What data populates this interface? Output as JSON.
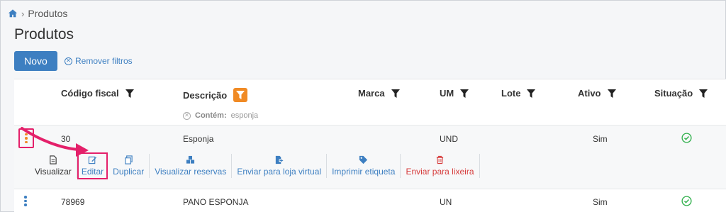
{
  "breadcrumb": {
    "home_icon": "home-icon",
    "current": "Produtos"
  },
  "page": {
    "title": "Produtos"
  },
  "toolbar": {
    "new_label": "Novo",
    "remove_filters_label": "Remover filtros"
  },
  "table": {
    "columns": [
      {
        "key": "codigo_fiscal",
        "label": "Código fiscal"
      },
      {
        "key": "descricao",
        "label": "Descrição",
        "filter_active": true
      },
      {
        "key": "marca",
        "label": "Marca"
      },
      {
        "key": "um",
        "label": "UM"
      },
      {
        "key": "lote",
        "label": "Lote"
      },
      {
        "key": "ativo",
        "label": "Ativo"
      },
      {
        "key": "situacao",
        "label": "Situação"
      }
    ],
    "active_filter": {
      "label": "Contém:",
      "value": "esponja"
    },
    "rows": [
      {
        "codigo_fiscal": "30",
        "descricao": "Esponja",
        "um": "UND",
        "ativo": "Sim",
        "situacao_icon": "check-circle-icon"
      },
      {
        "codigo_fiscal": "78969",
        "descricao": "PANO ESPONJA",
        "um": "UN",
        "ativo": "Sim",
        "situacao_icon": "check-circle-icon"
      }
    ],
    "row_actions": [
      {
        "label": "Visualizar",
        "icon": "document-icon"
      },
      {
        "label": "Editar",
        "icon": "edit-icon"
      },
      {
        "label": "Duplicar",
        "icon": "copy-icon"
      },
      {
        "label": "Visualizar reservas",
        "icon": "boxes-icon"
      },
      {
        "label": "Enviar para loja virtual",
        "icon": "send-document-icon"
      },
      {
        "label": "Imprimir etiqueta",
        "icon": "tag-icon"
      },
      {
        "label": "Enviar para lixeira",
        "icon": "trash-icon"
      }
    ]
  },
  "colors": {
    "primary": "#3d7fc1",
    "filter_active": "#f08a24",
    "highlight": "#e4206a",
    "success": "#2eaf4a",
    "danger": "#d63b3b"
  }
}
